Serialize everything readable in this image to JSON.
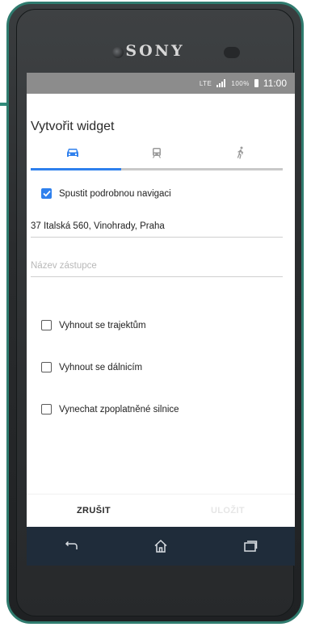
{
  "device": {
    "brand": "SONY"
  },
  "status_bar": {
    "network": "LTE",
    "battery": "100%",
    "time": "11:00"
  },
  "dialog": {
    "title": "Vytvořit widget",
    "tabs": [
      {
        "icon": "car-icon",
        "selected": true
      },
      {
        "icon": "transit-icon",
        "selected": false
      },
      {
        "icon": "walk-icon",
        "selected": false
      }
    ],
    "turn_by_turn": {
      "label": "Spustit podrobnou navigaci",
      "checked": true
    },
    "destination": {
      "value": "37 Italská 560, Vinohrady, Praha"
    },
    "shortcut_name": {
      "placeholder": "Název zástupce",
      "value": ""
    },
    "options": [
      {
        "label": "Vyhnout se trajektům",
        "checked": false
      },
      {
        "label": "Vyhnout se dálnicím",
        "checked": false
      },
      {
        "label": "Vynechat zpoplatněné silnice",
        "checked": false
      }
    ],
    "buttons": {
      "cancel": "ZRUŠIT",
      "save": "ULOŽIT"
    }
  },
  "colors": {
    "accent": "#2f80ed",
    "frame": "#2f7b6e",
    "nav_bar": "#1f2c3a",
    "arrow": "#2e8b7a"
  }
}
